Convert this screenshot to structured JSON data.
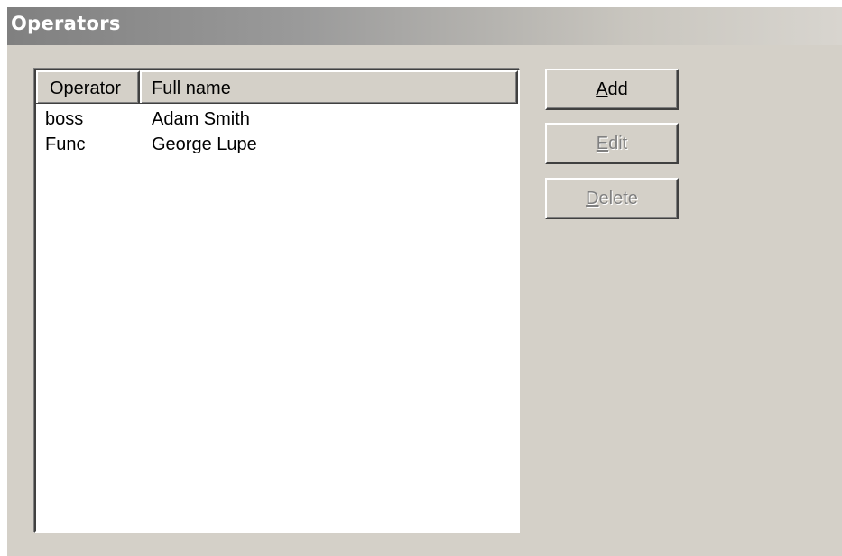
{
  "window": {
    "title": "Operators"
  },
  "list": {
    "columns": {
      "operator": "Operator",
      "full_name": "Full name"
    },
    "rows": [
      {
        "operator": "boss",
        "full_name": "Adam Smith"
      },
      {
        "operator": "Func",
        "full_name": "George Lupe"
      }
    ]
  },
  "buttons": {
    "add": {
      "mnemonic": "A",
      "rest": "dd",
      "enabled": true
    },
    "edit": {
      "mnemonic": "E",
      "rest": "dit",
      "enabled": false
    },
    "delete": {
      "mnemonic": "D",
      "rest": "elete",
      "enabled": false
    }
  }
}
